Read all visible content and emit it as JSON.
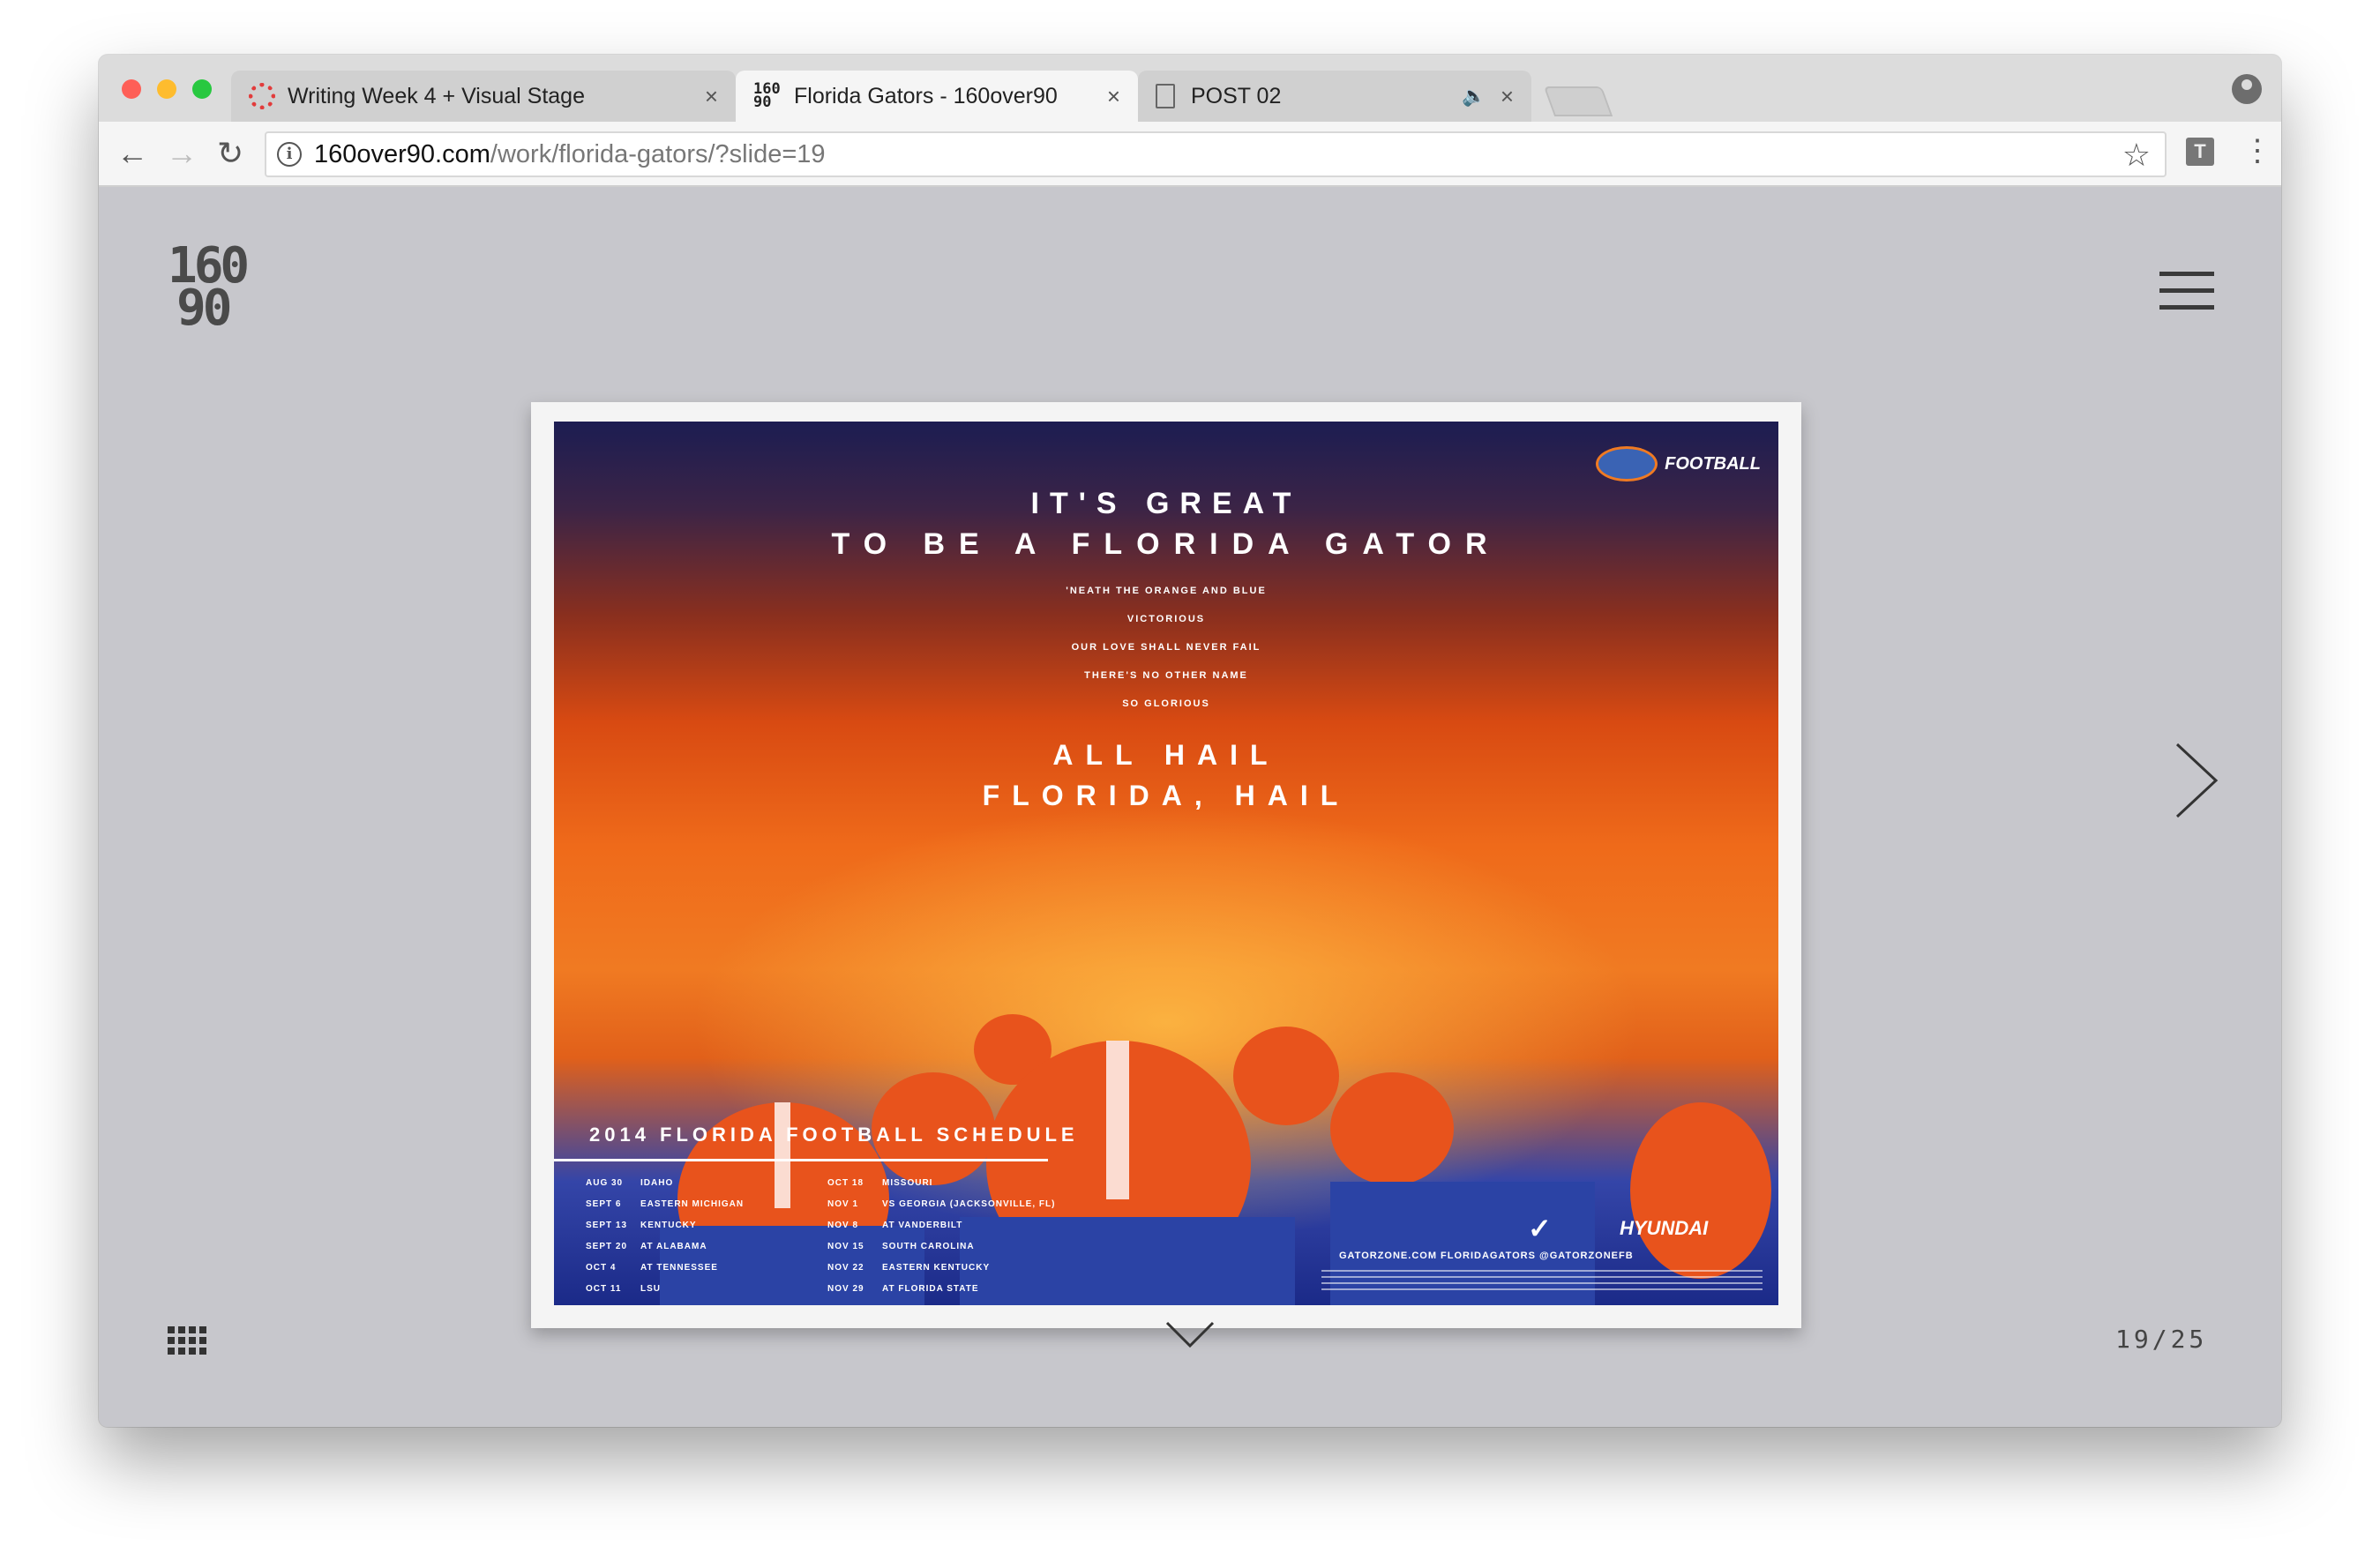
{
  "browser": {
    "tabs": [
      {
        "label": "Writing Week 4 + Visual Stage",
        "icon": "swirl-favicon-icon",
        "active": false
      },
      {
        "label": "Florida Gators - 160over90",
        "icon": "160over90-favicon-icon",
        "active": true
      },
      {
        "label": "POST 02",
        "icon": "document-icon",
        "active": false,
        "audio": true
      }
    ],
    "close_glyph": "×",
    "favicon_160_text": "160\n90",
    "url_host": "160over90.com",
    "url_path": "/work/florida-gators/?slide=19",
    "ext_label": "T"
  },
  "site": {
    "logo_line1": "160",
    "logo_line2": "90",
    "counter": "19/25"
  },
  "poster": {
    "brand_label": "FOOTBALL",
    "headline_1": "IT'S GREAT",
    "headline_2": "TO BE A FLORIDA GATOR",
    "lyrics": [
      "'NEATH THE ORANGE AND BLUE",
      "VICTORIOUS",
      "OUR LOVE SHALL NEVER FAIL",
      "THERE'S NO OTHER NAME",
      "SO GLORIOUS"
    ],
    "hail_1": "ALL HAIL",
    "hail_2": "FLORIDA, HAIL",
    "schedule_title": "2014 FLORIDA FOOTBALL SCHEDULE",
    "schedule_left": [
      {
        "date": "AUG 30",
        "game": "IDAHO"
      },
      {
        "date": "SEPT 6",
        "game": "EASTERN MICHIGAN"
      },
      {
        "date": "SEPT 13",
        "game": "KENTUCKY"
      },
      {
        "date": "SEPT 20",
        "game": "AT ALABAMA"
      },
      {
        "date": "OCT 4",
        "game": "AT TENNESSEE"
      },
      {
        "date": "OCT 11",
        "game": "LSU"
      }
    ],
    "schedule_right": [
      {
        "date": "OCT 18",
        "game": "MISSOURI"
      },
      {
        "date": "NOV 1",
        "game": "VS GEORGIA (JACKSONVILLE, FL)"
      },
      {
        "date": "NOV 8",
        "game": "AT VANDERBILT"
      },
      {
        "date": "NOV 15",
        "game": "SOUTH CAROLINA"
      },
      {
        "date": "NOV 22",
        "game": "EASTERN KENTUCKY"
      },
      {
        "date": "NOV 29",
        "game": "AT FLORIDA STATE"
      }
    ],
    "sponsor_1": "✓",
    "sponsor_2": "HYUNDAI",
    "links": "GATORZONE.COM     FLORIDAGATORS     @GATORZONEFB"
  }
}
